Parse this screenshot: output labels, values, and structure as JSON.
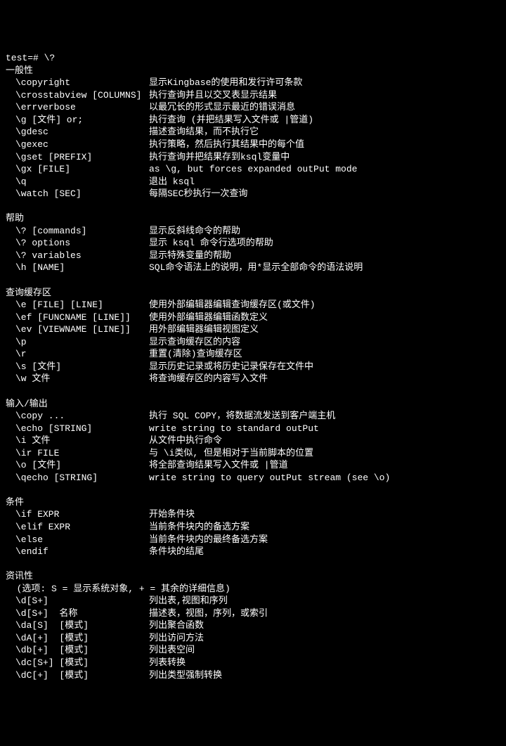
{
  "prompt": "test=# \\?",
  "sections": [
    {
      "title": "一般性",
      "items": [
        {
          "cmd": "\\copyright",
          "desc": "显示Kingbase的使用和发行许可条款"
        },
        {
          "cmd": "\\crosstabview [COLUMNS]",
          "desc": "执行查询并且以交叉表显示结果"
        },
        {
          "cmd": "\\errverbose",
          "desc": "以最冗长的形式显示最近的错误消息"
        },
        {
          "cmd": "\\g [文件] or;",
          "desc": "执行查询 (并把结果写入文件或 |管道)"
        },
        {
          "cmd": "\\gdesc",
          "desc": "描述查询结果，而不执行它"
        },
        {
          "cmd": "\\gexec",
          "desc": "执行策略，然后执行其结果中的每个值"
        },
        {
          "cmd": "\\gset [PREFIX]",
          "desc": "执行查询并把结果存到ksql变量中"
        },
        {
          "cmd": "\\gx [FILE]",
          "desc": "as \\g, but forces expanded outPut mode"
        },
        {
          "cmd": "\\q",
          "desc": "退出 ksql"
        },
        {
          "cmd": "\\watch [SEC]",
          "desc": "每隔SEC秒执行一次查询"
        }
      ]
    },
    {
      "title": "帮助",
      "items": [
        {
          "cmd": "\\? [commands]",
          "desc": "显示反斜线命令的帮助"
        },
        {
          "cmd": "\\? options",
          "desc": "显示 ksql 命令行选项的帮助"
        },
        {
          "cmd": "\\? variables",
          "desc": "显示特殊变量的帮助"
        },
        {
          "cmd": "\\h [NAME]",
          "desc": "SQL命令语法上的说明，用*显示全部命令的语法说明"
        }
      ]
    },
    {
      "title": "查询缓存区",
      "items": [
        {
          "cmd": "\\e [FILE] [LINE]",
          "desc": "使用外部编辑器编辑查询缓存区(或文件)"
        },
        {
          "cmd": "\\ef [FUNCNAME [LINE]]",
          "desc": "使用外部编辑器编辑函数定义"
        },
        {
          "cmd": "\\ev [VIEWNAME [LINE]]",
          "desc": "用外部编辑器编辑视图定义"
        },
        {
          "cmd": "\\p",
          "desc": "显示查询缓存区的内容"
        },
        {
          "cmd": "\\r",
          "desc": "重置(清除)查询缓存区"
        },
        {
          "cmd": "\\s [文件]",
          "desc": "显示历史记录或将历史记录保存在文件中"
        },
        {
          "cmd": "\\w 文件",
          "desc": "将查询缓存区的内容写入文件"
        }
      ]
    },
    {
      "title": "输入/输出",
      "items": [
        {
          "cmd": "\\copy ...",
          "desc": "执行 SQL COPY，将数据流发送到客户端主机"
        },
        {
          "cmd": "\\echo [STRING]",
          "desc": "write string to standard outPut"
        },
        {
          "cmd": "\\i 文件",
          "desc": "从文件中执行命令"
        },
        {
          "cmd": "\\ir FILE",
          "desc": "与 \\i类似, 但是相对于当前脚本的位置"
        },
        {
          "cmd": "\\o [文件]",
          "desc": "将全部查询结果写入文件或 |管道"
        },
        {
          "cmd": "\\qecho [STRING]",
          "desc": "write string to query outPut stream (see \\o)"
        }
      ]
    },
    {
      "title": "条件",
      "items": [
        {
          "cmd": "\\if EXPR",
          "desc": "开始条件块"
        },
        {
          "cmd": "\\elif EXPR",
          "desc": "当前条件块内的备选方案"
        },
        {
          "cmd": "\\else",
          "desc": "当前条件块内的最终备选方案"
        },
        {
          "cmd": "\\endif",
          "desc": "条件块的结尾"
        }
      ]
    },
    {
      "title": "资讯性",
      "subtitle": "  (选项: S = 显示系统对象, + = 其余的详细信息)",
      "items": [
        {
          "cmd": "\\d[S+]",
          "desc": "列出表,视图和序列"
        },
        {
          "cmd": "\\d[S+]  名称",
          "desc": "描述表，视图，序列，或索引"
        },
        {
          "cmd": "\\da[S]  [模式]",
          "desc": "列出聚合函数"
        },
        {
          "cmd": "\\dA[+]  [模式]",
          "desc": "列出访问方法"
        },
        {
          "cmd": "\\db[+]  [模式]",
          "desc": "列出表空间"
        },
        {
          "cmd": "\\dc[S+] [模式]",
          "desc": "列表转换"
        },
        {
          "cmd": "\\dC[+]  [模式]",
          "desc": "列出类型强制转换"
        }
      ]
    }
  ]
}
